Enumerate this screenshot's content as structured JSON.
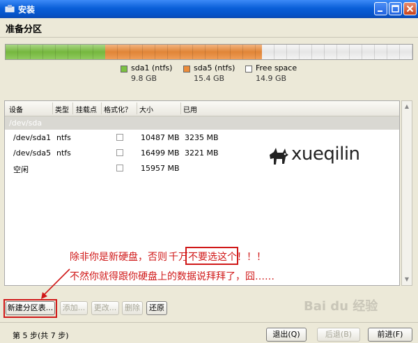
{
  "window": {
    "title": "安装"
  },
  "page": {
    "heading": "准备分区"
  },
  "partitions": [
    {
      "name": "sda1 (ntfs)",
      "size": "9.8 GB",
      "color": "#7cc142",
      "fraction": 0.245
    },
    {
      "name": "sda5 (ntfs)",
      "size": "15.4 GB",
      "color": "#ec8c3a",
      "fraction": 0.385
    },
    {
      "name": "Free space",
      "size": "14.9 GB",
      "color": "#ffffff",
      "fraction": 0.37
    }
  ],
  "table": {
    "headers": [
      "设备",
      "类型",
      "挂载点",
      "格式化？",
      "大小",
      "已用"
    ],
    "group": "/dev/sda",
    "rows": [
      {
        "device": "/dev/sda1",
        "type": "ntfs",
        "mount": "",
        "size": "10487 MB",
        "used": "3235 MB"
      },
      {
        "device": "/dev/sda5",
        "type": "ntfs",
        "mount": "",
        "size": "16499 MB",
        "used": "3221 MB"
      },
      {
        "device": "空闲",
        "type": "",
        "mount": "",
        "size": "15957 MB",
        "used": ""
      }
    ]
  },
  "watermark": {
    "text": "xueqilin"
  },
  "annotation": {
    "line1_a": "除非你是新硬盘，否则",
    "line1_b": "千万不要",
    "line1_c": "选这个！！！",
    "line2": "不然你就得跟你硬盘上的数据说拜拜了，囧……"
  },
  "actions": {
    "new_table": "新建分区表...",
    "add": "添加...",
    "change": "更改...",
    "delete": "删除",
    "revert": "还原"
  },
  "footer": {
    "step": "第 5 步(共 7 步)",
    "quit": "退出(Q)",
    "back": "后退(B)",
    "forward": "前进(F)",
    "brand": "Bai du 经验"
  }
}
